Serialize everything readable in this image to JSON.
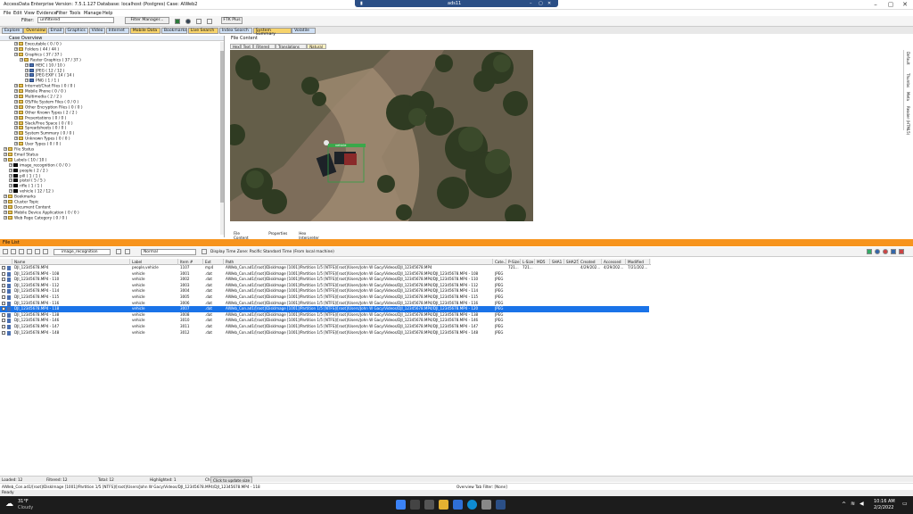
{
  "window": {
    "title": "AccessData Enterprise Version: 7.5.1.127 Database: localhost (Postgres) Case: AIWeb2"
  },
  "remote": {
    "label": "ads11"
  },
  "menu": [
    "File",
    "Edit",
    "View",
    "Evidence",
    "Filter",
    "Tools",
    "Manage",
    "Help"
  ],
  "toolbar": {
    "filter_label": "Filter:",
    "filter_value": "unfiltered",
    "filter_manager": "Filter Manager...",
    "ftk_plus": "FTK Plus"
  },
  "tabs": [
    {
      "label": "Explore",
      "color": "#cfe0f5"
    },
    {
      "label": "Overview",
      "color": "#f7d36b"
    },
    {
      "label": "Email",
      "color": "#cfe0f5"
    },
    {
      "label": "Graphics",
      "color": "#cfe0f5"
    },
    {
      "label": "Video",
      "color": "#cfe0f5"
    },
    {
      "label": "Internet",
      "color": "#cfe0f5"
    },
    {
      "label": "Mobile Data",
      "color": "#f7d36b"
    },
    {
      "label": "Bookmarks",
      "color": "#cfe0f5"
    },
    {
      "label": "Live Search",
      "color": "#f7d36b"
    },
    {
      "label": "Index Search",
      "color": "#cfe0f5"
    },
    {
      "label": "System Summary",
      "color": "#f7d36b"
    },
    {
      "label": "Volatile",
      "color": "#cfe0f5"
    }
  ],
  "case_overview": {
    "title": "Case Overview",
    "tree": [
      {
        "label": "Executable ( 0 / 0 )",
        "indent": 2,
        "type": "cat"
      },
      {
        "label": "Folders ( 44 / 44 )",
        "indent": 2,
        "type": "cat"
      },
      {
        "label": "Graphics ( 37 / 37 )",
        "indent": 2,
        "type": "cat"
      },
      {
        "label": "Raster Graphics ( 37 / 37 )",
        "indent": 3,
        "type": "cat"
      },
      {
        "label": "HEIC ( 10 / 10 )",
        "indent": 4,
        "type": "file"
      },
      {
        "label": "JPEG ( 12 / 12 )",
        "indent": 4,
        "type": "file"
      },
      {
        "label": "JPEG EXIF ( 14 / 14 )",
        "indent": 4,
        "type": "file"
      },
      {
        "label": "PNG ( 1 / 1 )",
        "indent": 4,
        "type": "file"
      },
      {
        "label": "Internet/Chat Files ( 0 / 0 )",
        "indent": 2,
        "type": "cat"
      },
      {
        "label": "Mobile Phone ( 0 / 0 )",
        "indent": 2,
        "type": "cat"
      },
      {
        "label": "Multimedia ( 2 / 2 )",
        "indent": 2,
        "type": "cat"
      },
      {
        "label": "OS/File System Files ( 0 / 0 )",
        "indent": 2,
        "type": "cat"
      },
      {
        "label": "Other Encryption Files ( 0 / 0 )",
        "indent": 2,
        "type": "cat"
      },
      {
        "label": "Other Known Types ( 2 / 2 )",
        "indent": 2,
        "type": "cat"
      },
      {
        "label": "Presentations ( 0 / 0 )",
        "indent": 2,
        "type": "cat"
      },
      {
        "label": "Slack/Free Space ( 0 / 0 )",
        "indent": 2,
        "type": "cat"
      },
      {
        "label": "Spreadsheets ( 0 / 0 )",
        "indent": 2,
        "type": "cat"
      },
      {
        "label": "System Summary ( 0 / 0 )",
        "indent": 2,
        "type": "cat"
      },
      {
        "label": "Unknown Types ( 0 / 0 )",
        "indent": 2,
        "type": "cat"
      },
      {
        "label": "User Types ( 0 / 0 )",
        "indent": 2,
        "type": "cat"
      },
      {
        "label": "File Status",
        "indent": 0,
        "type": "cat"
      },
      {
        "label": "Email Status",
        "indent": 0,
        "type": "cat"
      },
      {
        "label": "Labels ( 10 / 10 )",
        "indent": 0,
        "type": "cat"
      },
      {
        "label": "image_recognition ( 0 / 0 )",
        "indent": 1,
        "type": "label"
      },
      {
        "label": "people ( 2 / 2 )",
        "indent": 1,
        "type": "label"
      },
      {
        "label": "pill ( 1 / 1 )",
        "indent": 1,
        "type": "label"
      },
      {
        "label": "pistol ( 5 / 5 )",
        "indent": 1,
        "type": "label"
      },
      {
        "label": "rifle ( 1 / 1 )",
        "indent": 1,
        "type": "label"
      },
      {
        "label": "vehicle ( 12 / 12 )",
        "indent": 1,
        "type": "label"
      },
      {
        "label": "Bookmarks",
        "indent": 0,
        "type": "cat"
      },
      {
        "label": "Cluster Topic",
        "indent": 0,
        "type": "cat"
      },
      {
        "label": "Document Content",
        "indent": 0,
        "type": "cat"
      },
      {
        "label": "Mobile Device Application ( 0 / 0 )",
        "indent": 0,
        "type": "cat"
      },
      {
        "label": "Web Page Category ( 0 / 0 )",
        "indent": 0,
        "type": "cat"
      }
    ]
  },
  "file_content": {
    "title": "File Content",
    "view_tabs": [
      "Hex",
      "Text",
      "Filtered",
      "Translations",
      "Natural"
    ],
    "bottom_tabs": [
      "File Content",
      "Properties",
      "Hex Interpreter"
    ],
    "detection_label": "vehicle",
    "side_tabs": [
      "Default",
      "Thumbs",
      "Meta",
      "Reader (HTML5)"
    ]
  },
  "file_list": {
    "title": "File List",
    "label_select": "image_recognition",
    "view_select": "Normal",
    "timezone": "Display Time Zone: Pacific Standard Time  (From local machine)",
    "columns": [
      "Name",
      "Label",
      "Item #",
      "Ext",
      "Path",
      "Cate...",
      "P-Size",
      "L-Size",
      "MD5",
      "SHA1",
      "SHA256",
      "Created",
      "Accessed",
      "Modified"
    ],
    "rows": [
      {
        "name": "DJI_12345678.MP4",
        "label": "people,vehicle",
        "item": "1107",
        "ext": "mp4",
        "path": "AIWeb_Con.ad1/[root]/DiskImage [1001]/Partition 1/5 [NTFS]/[root]/Users/John W Gacy/Videos/DJI_12345678.MP4",
        "cat": "",
        "psize": "721...",
        "lsize": "721...",
        "created": "4/29/202...",
        "accessed": "4/29/202...",
        "modified": "7/21/202...",
        "selected": false
      },
      {
        "name": "DJI_12345678.MP4 - 108",
        "label": "vehicle",
        "item": "3001",
        "ext": ".dat",
        "path": "AIWeb_Con.ad1/[root]/DiskImage [1001]/Partition 1/5 [NTFS]/[root]/Users/John W Gacy/Videos/DJI_12345678.MP4/DJI_12345678.MP4 - 108",
        "cat": "JPEG",
        "psize": "",
        "lsize": "",
        "created": "",
        "accessed": "",
        "modified": "",
        "selected": false
      },
      {
        "name": "DJI_12345678.MP4 - 110",
        "label": "vehicle",
        "item": "3002",
        "ext": ".dat",
        "path": "AIWeb_Con.ad1/[root]/DiskImage [1001]/Partition 1/5 [NTFS]/[root]/Users/John W Gacy/Videos/DJI_12345678.MP4/DJI_12345678.MP4 - 110",
        "cat": "JPEG",
        "psize": "",
        "lsize": "",
        "created": "",
        "accessed": "",
        "modified": "",
        "selected": false
      },
      {
        "name": "DJI_12345678.MP4 - 112",
        "label": "vehicle",
        "item": "3003",
        "ext": ".dat",
        "path": "AIWeb_Con.ad1/[root]/DiskImage [1001]/Partition 1/5 [NTFS]/[root]/Users/John W Gacy/Videos/DJI_12345678.MP4/DJI_12345678.MP4 - 112",
        "cat": "JPEG",
        "psize": "",
        "lsize": "",
        "created": "",
        "accessed": "",
        "modified": "",
        "selected": false
      },
      {
        "name": "DJI_12345678.MP4 - 114",
        "label": "vehicle",
        "item": "3004",
        "ext": ".dat",
        "path": "AIWeb_Con.ad1/[root]/DiskImage [1001]/Partition 1/5 [NTFS]/[root]/Users/John W Gacy/Videos/DJI_12345678.MP4/DJI_12345678.MP4 - 114",
        "cat": "JPEG",
        "psize": "",
        "lsize": "",
        "created": "",
        "accessed": "",
        "modified": "",
        "selected": false
      },
      {
        "name": "DJI_12345678.MP4 - 115",
        "label": "vehicle",
        "item": "3005",
        "ext": ".dat",
        "path": "AIWeb_Con.ad1/[root]/DiskImage [1001]/Partition 1/5 [NTFS]/[root]/Users/John W Gacy/Videos/DJI_12345678.MP4/DJI_12345678.MP4 - 115",
        "cat": "JPEG",
        "psize": "",
        "lsize": "",
        "created": "",
        "accessed": "",
        "modified": "",
        "selected": false
      },
      {
        "name": "DJI_12345678.MP4 - 116",
        "label": "vehicle",
        "item": "3006",
        "ext": ".dat",
        "path": "AIWeb_Con.ad1/[root]/DiskImage [1001]/Partition 1/5 [NTFS]/[root]/Users/John W Gacy/Videos/DJI_12345678.MP4/DJI_12345678.MP4 - 116",
        "cat": "JPEG",
        "psize": "",
        "lsize": "",
        "created": "",
        "accessed": "",
        "modified": "",
        "selected": false
      },
      {
        "name": "DJI_12345678.MP4 - 118",
        "label": "vehicle",
        "item": "3007",
        "ext": ".dat",
        "path": "AIWeb_Con.ad1/[root]/DiskImage [1001]/Partition 1/5 [NTFS]/[root]/Users/John W Gacy/Videos/DJI_12345678.MP4/DJI_12345678.MP4 - 120",
        "cat": "JPEG",
        "psize": "",
        "lsize": "",
        "created": "",
        "accessed": "",
        "modified": "",
        "selected": true
      },
      {
        "name": "DJI_12345678.MP4 - 138",
        "label": "vehicle",
        "item": "3008",
        "ext": ".dat",
        "path": "AIWeb_Con.ad1/[root]/DiskImage [1001]/Partition 1/5 [NTFS]/[root]/Users/John W Gacy/Videos/DJI_12345678.MP4/DJI_12345678.MP4 - 138",
        "cat": "JPEG",
        "psize": "",
        "lsize": "",
        "created": "",
        "accessed": "",
        "modified": "",
        "selected": false
      },
      {
        "name": "DJI_12345678.MP4 - 146",
        "label": "vehicle",
        "item": "3010",
        "ext": ".dat",
        "path": "AIWeb_Con.ad1/[root]/DiskImage [1001]/Partition 1/5 [NTFS]/[root]/Users/John W Gacy/Videos/DJI_12345678.MP4/DJI_12345678.MP4 - 146",
        "cat": "JPEG",
        "psize": "",
        "lsize": "",
        "created": "",
        "accessed": "",
        "modified": "",
        "selected": false
      },
      {
        "name": "DJI_12345678.MP4 - 147",
        "label": "vehicle",
        "item": "3011",
        "ext": ".dat",
        "path": "AIWeb_Con.ad1/[root]/DiskImage [1001]/Partition 1/5 [NTFS]/[root]/Users/John W Gacy/Videos/DJI_12345678.MP4/DJI_12345678.MP4 - 147",
        "cat": "JPEG",
        "psize": "",
        "lsize": "",
        "created": "",
        "accessed": "",
        "modified": "",
        "selected": false
      },
      {
        "name": "DJI_12345678.MP4 - 148",
        "label": "vehicle",
        "item": "3012",
        "ext": ".dat",
        "path": "AIWeb_Con.ad1/[root]/DiskImage [1001]/Partition 1/5 [NTFS]/[root]/Users/John W Gacy/Videos/DJI_12345678.MP4/DJI_12345678.MP4 - 148",
        "cat": "JPEG",
        "psize": "",
        "lsize": "",
        "created": "",
        "accessed": "",
        "modified": "",
        "selected": false
      }
    ]
  },
  "status": {
    "loaded": "Loaded: 12",
    "filtered": "Filtered: 12",
    "total": "Total: 12",
    "highlighted": "Highlighted: 1",
    "checked": "Checked: 0",
    "update": "Click to update size"
  },
  "path_bar": {
    "path": "AIWeb_Con.ad1/[root]/DiskImage [1001]/Partition 1/5 [NTFS]/[root]/Users/John W Gacy/Videos/DJI_12345678.MP4/DJI_12345678.MP4 - 118",
    "tab_filter": "Overview Tab Filter: [None]"
  },
  "ready": "Ready",
  "taskbar": {
    "temp": "31°F",
    "weather": "Cloudy",
    "time": "10:16 AM",
    "date": "2/2/2022"
  },
  "colors": {
    "orange": "#f7941d",
    "selection": "#1a73e8",
    "taskbar": "#1c1c1c"
  }
}
